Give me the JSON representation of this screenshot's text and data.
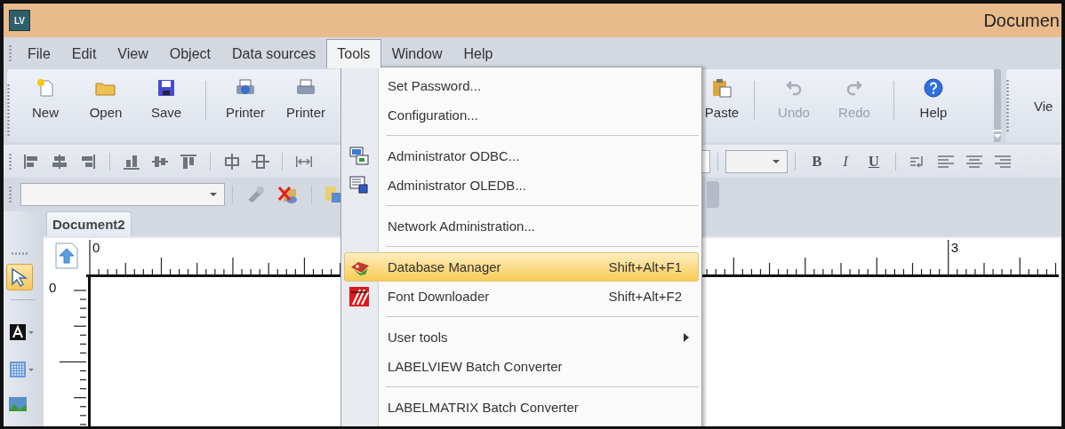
{
  "window": {
    "logo": "LV",
    "title": "Documen"
  },
  "menu_bar": [
    {
      "label": "File",
      "selected": false
    },
    {
      "label": "Edit",
      "selected": false
    },
    {
      "label": "View",
      "selected": false
    },
    {
      "label": "Object",
      "selected": false
    },
    {
      "label": "Data sources",
      "selected": false
    },
    {
      "label": "Tools",
      "selected": true
    },
    {
      "label": "Window",
      "selected": false
    },
    {
      "label": "Help",
      "selected": false
    }
  ],
  "toolbar": {
    "left": [
      {
        "label": "New",
        "disabled": false
      },
      {
        "label": "Open",
        "disabled": false
      },
      {
        "label": "Save",
        "disabled": false
      },
      {
        "label": "Printer",
        "disabled": false
      },
      {
        "label": "Printer",
        "disabled": false
      }
    ],
    "right": [
      {
        "label": "Paste",
        "disabled": false
      },
      {
        "label": "Undo",
        "disabled": true
      },
      {
        "label": "Redo",
        "disabled": true
      },
      {
        "label": "Help",
        "disabled": false
      }
    ],
    "next_toolbar": "Vie"
  },
  "format_toolbar": {
    "text_styles": [
      "B",
      "I",
      "U"
    ]
  },
  "document_tab": {
    "label": "Document2"
  },
  "toolbox": [
    {
      "selected": true
    },
    {
      "selected": false
    },
    {
      "selected": false
    },
    {
      "selected": false
    }
  ],
  "ruler": {
    "horizontal_labels": [
      "0",
      "3"
    ],
    "vertical_labels": [
      "0"
    ]
  },
  "tools_menu": [
    {
      "kind": "item",
      "label": "Set Password...",
      "selected": false
    },
    {
      "kind": "item",
      "label": "Configuration...",
      "selected": false
    },
    {
      "kind": "separator"
    },
    {
      "kind": "item",
      "label": "Administrator ODBC...",
      "selected": false
    },
    {
      "kind": "item",
      "label": "Administrator OLEDB...",
      "selected": false
    },
    {
      "kind": "separator"
    },
    {
      "kind": "item",
      "label": "Network Administration...",
      "selected": false
    },
    {
      "kind": "separator"
    },
    {
      "kind": "item",
      "label": "Database Manager",
      "shortcut": "Shift+Alt+F1",
      "selected": true
    },
    {
      "kind": "item",
      "label": "Font Downloader",
      "shortcut": "Shift+Alt+F2",
      "selected": false
    },
    {
      "kind": "separator"
    },
    {
      "kind": "submenu",
      "label": "User tools",
      "selected": false
    },
    {
      "kind": "item",
      "label": "LABELVIEW Batch Converter",
      "selected": false
    },
    {
      "kind": "separator"
    },
    {
      "kind": "item",
      "label": "LABELMATRIX Batch Converter",
      "selected": false
    }
  ]
}
